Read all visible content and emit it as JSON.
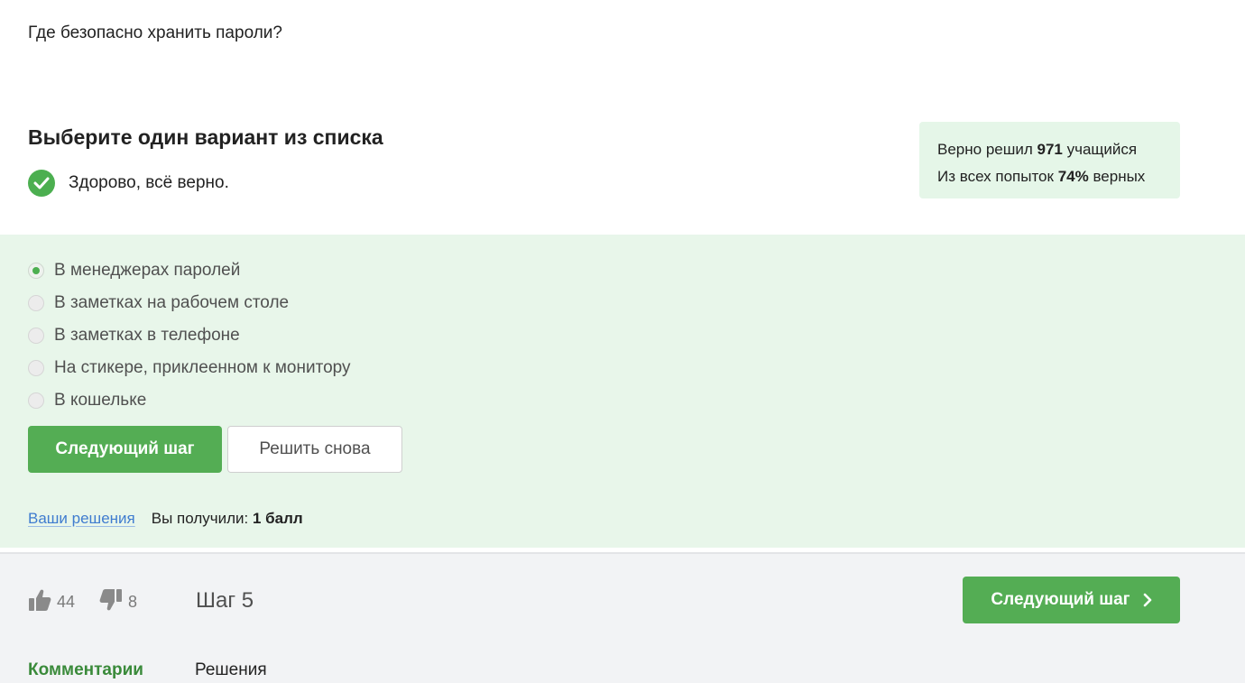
{
  "question": {
    "text": "Где безопасно хранить пароли?"
  },
  "quiz": {
    "title": "Выберите один вариант из списка",
    "feedback": "Здорово, всё верно."
  },
  "stats": {
    "solved_prefix": "Верно решил ",
    "solved_count": "971",
    "solved_suffix": " учащийся",
    "attempts_prefix": "Из всех попыток ",
    "attempts_percent": "74%",
    "attempts_suffix": " верных"
  },
  "options": [
    {
      "label": "В менеджерах паролей",
      "selected": true
    },
    {
      "label": "В заметках на рабочем столе",
      "selected": false
    },
    {
      "label": "В заметках в телефоне",
      "selected": false
    },
    {
      "label": "На стикере, приклеенном к монитору",
      "selected": false
    },
    {
      "label": "В кошельке",
      "selected": false
    }
  ],
  "actions": {
    "next_label": "Следующий шаг",
    "retry_label": "Решить снова"
  },
  "result": {
    "solutions_link": "Ваши решения",
    "received_label": "Вы получили: ",
    "score": "1 балл"
  },
  "footer": {
    "likes": "44",
    "dislikes": "8",
    "step": "Шаг 5",
    "next_step_label": "Следующий шаг",
    "tabs": [
      "Комментарии",
      "Решения"
    ]
  },
  "colors": {
    "accent_green": "#54ad54",
    "answers_bg": "#e8f6ea",
    "link_blue": "#3f7ccf"
  }
}
